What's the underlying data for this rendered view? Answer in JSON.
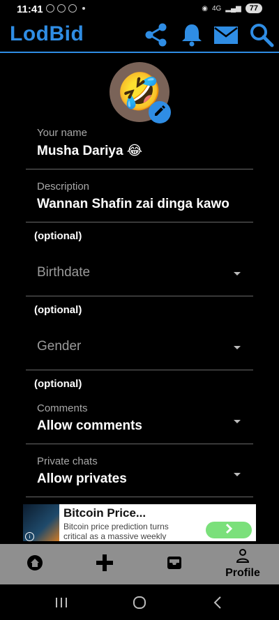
{
  "status_bar": {
    "time": "11:41",
    "network": "4G",
    "battery": "77"
  },
  "app": {
    "title": "LodBid"
  },
  "appbar_icons": [
    "share-icon",
    "bell-icon",
    "mail-icon",
    "search-icon"
  ],
  "avatar": {
    "emoji": "🤣"
  },
  "fields": {
    "name": {
      "label": "Your name",
      "value": "Musha Dariya 😂"
    },
    "description": {
      "label": "Description",
      "value": "Wannan Shafin zai dinga kawo"
    },
    "birthdate": {
      "optional": "(optional)",
      "placeholder": "Birthdate"
    },
    "gender": {
      "optional": "(optional)",
      "placeholder": "Gender"
    },
    "comments": {
      "optional": "(optional)",
      "label": "Comments",
      "value": "Allow comments"
    },
    "private_chats": {
      "label": "Private chats",
      "value": "Allow privates"
    }
  },
  "ad": {
    "title": "Bitcoin Price...",
    "description": "Bitcoin price prediction turns critical as a massive weekly"
  },
  "bottom_nav": {
    "items": [
      {
        "icon": "home-icon"
      },
      {
        "icon": "plus-icon"
      },
      {
        "icon": "inbox-icon"
      },
      {
        "icon": "profile-icon",
        "label": "Profile"
      }
    ]
  },
  "colors": {
    "accent": "#2f8de4",
    "nav_bg": "#8f8f8f",
    "background": "#000000"
  }
}
